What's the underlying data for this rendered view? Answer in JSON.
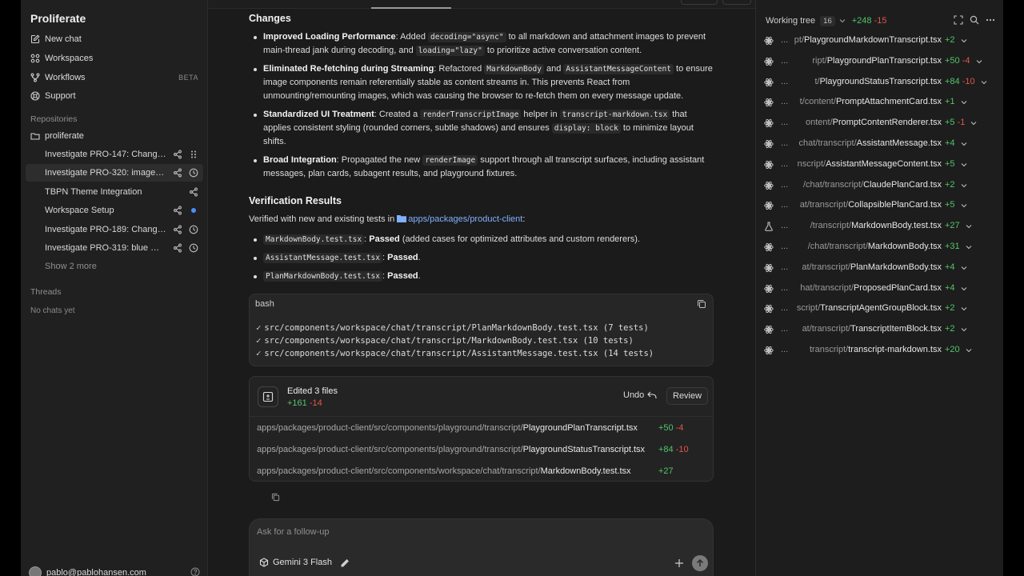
{
  "sidebar": {
    "brand": "Proliferate",
    "nav": [
      {
        "label": "New chat",
        "icon": "edit-icon"
      },
      {
        "label": "Workspaces",
        "icon": "grid-icon"
      },
      {
        "label": "Workflows",
        "icon": "workflow-icon",
        "badge": "BETA"
      },
      {
        "label": "Support",
        "icon": "support-icon"
      }
    ],
    "repos_label": "Repositories",
    "repo": "proliferate",
    "branches": [
      {
        "label": "Investigate PRO-147: Change i..."
      },
      {
        "label": "Investigate PRO-320: image lo..."
      },
      {
        "label": "TBPN Theme Integration"
      },
      {
        "label": "Workspace Setup"
      },
      {
        "label": "Investigate PRO-189: Changes ..."
      },
      {
        "label": "Investigate PRO-319: blue mar..."
      }
    ],
    "show_more": "Show 2 more",
    "threads_label": "Threads",
    "threads_empty": "No chats yet",
    "user": "pablo@pablohansen.com"
  },
  "main": {
    "changes_title": "Changes",
    "bullets": [
      {
        "bold": "Improved Loading Performance",
        "t1": ": Added ",
        "c1": "decoding=\"async\"",
        "t2": " to all markdown and attachment images to prevent main-thread jank during decoding, and ",
        "c2": "loading=\"lazy\"",
        "t3": " to prioritize active conversation content."
      },
      {
        "bold": "Eliminated Re-fetching during Streaming",
        "t1": ": Refactored ",
        "c1": "MarkdownBody",
        "t2": " and ",
        "c2": "AssistantMessageContent",
        "t3": " to ensure image components remain referentially stable as content streams in. This prevents React from unmounting/remounting images, which was causing the browser to re-fetch them on every message update."
      },
      {
        "bold": "Standardized UI Treatment",
        "t1": ": Created a ",
        "c1": "renderTranscriptImage",
        "t2": " helper in ",
        "c2": "transcript-markdown.tsx",
        "t3": " that applies consistent styling (rounded corners, subtle shadows) and ensures ",
        "c3": "display: block",
        "t4": " to minimize layout shifts."
      },
      {
        "bold": "Broad Integration",
        "t1": ": Propagated the new ",
        "c1": "renderImage",
        "t2": " support through all transcript surfaces, including assistant messages, plan cards, subagent results, and playground fixtures."
      }
    ],
    "verify_title": "Verification Results",
    "verify_intro": "Verified with new and existing tests in ",
    "verify_path": "apps/packages/product-client",
    "verify_colon": ":",
    "tests": [
      {
        "file": "MarkdownBody.test.tsx",
        "sep": ": ",
        "status": "Passed",
        "note": " (added cases for optimized attributes and custom renderers)."
      },
      {
        "file": "AssistantMessage.test.tsx",
        "sep": ": ",
        "status": "Passed",
        "note": "."
      },
      {
        "file": "PlanMarkdownBody.test.tsx",
        "sep": ": ",
        "status": "Passed",
        "note": "."
      }
    ],
    "bash": {
      "title": "bash",
      "check": "✓",
      "lines": [
        "src/components/workspace/chat/transcript/PlanMarkdownBody.test.tsx (7 tests)",
        "src/components/workspace/chat/transcript/MarkdownBody.test.tsx (10 tests)",
        "src/components/workspace/chat/transcript/AssistantMessage.test.tsx (14 tests)"
      ]
    },
    "edited": {
      "title": "Edited 3 files",
      "add": "+161",
      "del": "-14",
      "undo": "Undo",
      "review": "Review",
      "files": [
        {
          "dir": "apps/packages/product-client/src/components/playground/transcript/",
          "name": "PlaygroundPlanTranscript.tsx",
          "add": "+50",
          "del": "-4"
        },
        {
          "dir": "apps/packages/product-client/src/components/playground/transcript/",
          "name": "PlaygroundStatusTranscript.tsx",
          "add": "+84",
          "del": "-10"
        },
        {
          "dir": "apps/packages/product-client/src/components/workspace/chat/transcript/",
          "name": "MarkdownBody.test.tsx",
          "add": "+27",
          "del": ""
        }
      ]
    },
    "composer": {
      "placeholder": "Ask for a follow-up",
      "model": "Gemini 3 Flash"
    }
  },
  "right": {
    "title": "Working tree",
    "count": "16",
    "add": "+248",
    "del": "-15",
    "files": [
      {
        "dir": "pt/",
        "name": "PlaygroundMarkdownTranscript.tsx",
        "add": "+2",
        "del": "",
        "icon": "react-icon"
      },
      {
        "dir": "ript/",
        "name": "PlaygroundPlanTranscript.tsx",
        "add": "+50",
        "del": "-4",
        "icon": "react-icon"
      },
      {
        "dir": "t/",
        "name": "PlaygroundStatusTranscript.tsx",
        "add": "+84",
        "del": "-10",
        "icon": "react-icon"
      },
      {
        "dir": "t/content/",
        "name": "PromptAttachmentCard.tsx",
        "add": "+1",
        "del": "",
        "icon": "react-icon"
      },
      {
        "dir": "ontent/",
        "name": "PromptContentRenderer.tsx",
        "add": "+5",
        "del": "-1",
        "icon": "react-icon"
      },
      {
        "dir": "chat/transcript/",
        "name": "AssistantMessage.tsx",
        "add": "+4",
        "del": "",
        "icon": "react-icon"
      },
      {
        "dir": "nscript/",
        "name": "AssistantMessageContent.tsx",
        "add": "+5",
        "del": "",
        "icon": "react-icon"
      },
      {
        "dir": "/chat/transcript/",
        "name": "ClaudePlanCard.tsx",
        "add": "+2",
        "del": "",
        "icon": "react-icon"
      },
      {
        "dir": "at/transcript/",
        "name": "CollapsiblePlanCard.tsx",
        "add": "+5",
        "del": "",
        "icon": "react-icon"
      },
      {
        "dir": "/transcript/",
        "name": "MarkdownBody.test.tsx",
        "add": "+27",
        "del": "",
        "icon": "flask-icon"
      },
      {
        "dir": "/chat/transcript/",
        "name": "MarkdownBody.tsx",
        "add": "+31",
        "del": "",
        "icon": "react-icon"
      },
      {
        "dir": "at/transcript/",
        "name": "PlanMarkdownBody.tsx",
        "add": "+4",
        "del": "",
        "icon": "react-icon"
      },
      {
        "dir": "hat/transcript/",
        "name": "ProposedPlanCard.tsx",
        "add": "+4",
        "del": "",
        "icon": "react-icon"
      },
      {
        "dir": "script/",
        "name": "TranscriptAgentGroupBlock.tsx",
        "add": "+2",
        "del": "",
        "icon": "react-icon"
      },
      {
        "dir": "at/transcript/",
        "name": "TranscriptItemBlock.tsx",
        "add": "+2",
        "del": "",
        "icon": "react-icon"
      },
      {
        "dir": "transcript/",
        "name": "transcript-markdown.tsx",
        "add": "+20",
        "del": "",
        "icon": "react-icon"
      }
    ]
  },
  "ellipsis": "...",
  "colors": {
    "add": "#52c46a",
    "del": "#e5534b",
    "link": "#7fb1ff"
  }
}
